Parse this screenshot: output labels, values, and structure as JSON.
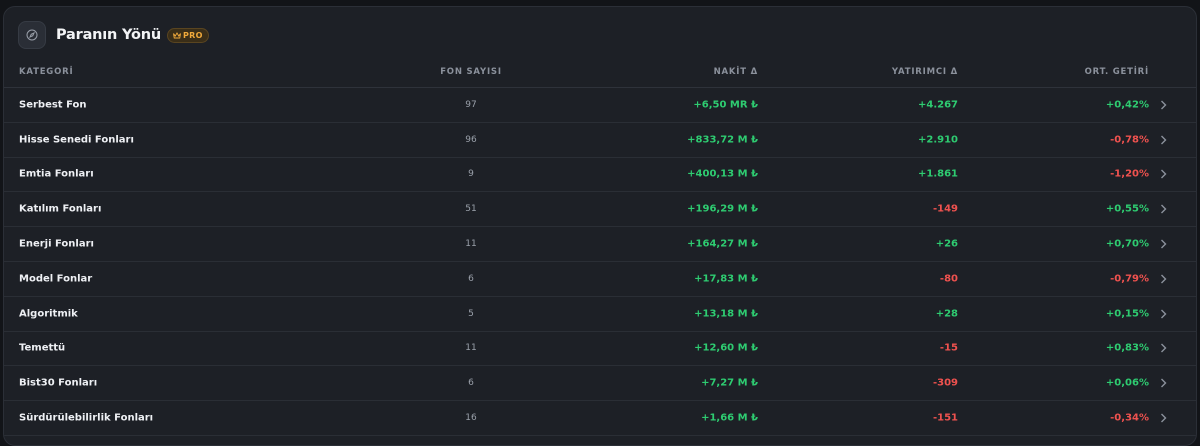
{
  "header": {
    "title": "Paranın Yönü",
    "badge": "PRO",
    "icon": "compass-icon"
  },
  "table": {
    "columns": {
      "kategori": "KATEGORİ",
      "fon_sayisi": "FON SAYISI",
      "nakit": "NAKİT Δ",
      "yatirimci": "YATIRIMCI Δ",
      "ort_getiri": "ORT. GETİRİ"
    },
    "rows": [
      {
        "kategori": "Serbest Fon",
        "fon_sayisi": "97",
        "nakit": "+6,50 MR ₺",
        "yatirimci": "+4.267",
        "ort_getiri": "+0,42%"
      },
      {
        "kategori": "Hisse Senedi Fonları",
        "fon_sayisi": "96",
        "nakit": "+833,72 M ₺",
        "yatirimci": "+2.910",
        "ort_getiri": "-0,78%"
      },
      {
        "kategori": "Emtia Fonları",
        "fon_sayisi": "9",
        "nakit": "+400,13 M ₺",
        "yatirimci": "+1.861",
        "ort_getiri": "-1,20%"
      },
      {
        "kategori": "Katılım Fonları",
        "fon_sayisi": "51",
        "nakit": "+196,29 M ₺",
        "yatirimci": "-149",
        "ort_getiri": "+0,55%"
      },
      {
        "kategori": "Enerji Fonları",
        "fon_sayisi": "11",
        "nakit": "+164,27 M ₺",
        "yatirimci": "+26",
        "ort_getiri": "+0,70%"
      },
      {
        "kategori": "Model Fonlar",
        "fon_sayisi": "6",
        "nakit": "+17,83 M ₺",
        "yatirimci": "-80",
        "ort_getiri": "-0,79%"
      },
      {
        "kategori": "Algoritmik",
        "fon_sayisi": "5",
        "nakit": "+13,18 M ₺",
        "yatirimci": "+28",
        "ort_getiri": "+0,15%"
      },
      {
        "kategori": "Temettü",
        "fon_sayisi": "11",
        "nakit": "+12,60 M ₺",
        "yatirimci": "-15",
        "ort_getiri": "+0,83%"
      },
      {
        "kategori": "Bist30 Fonları",
        "fon_sayisi": "6",
        "nakit": "+7,27 M ₺",
        "yatirimci": "-309",
        "ort_getiri": "+0,06%"
      },
      {
        "kategori": "Sürdürülebilirlik Fonları",
        "fon_sayisi": "16",
        "nakit": "+1,66 M ₺",
        "yatirimci": "-151",
        "ort_getiri": "-0,34%"
      }
    ]
  },
  "colors": {
    "positive": "#2ecc71",
    "negative": "#f0524f",
    "badge": "#f0a93b"
  }
}
